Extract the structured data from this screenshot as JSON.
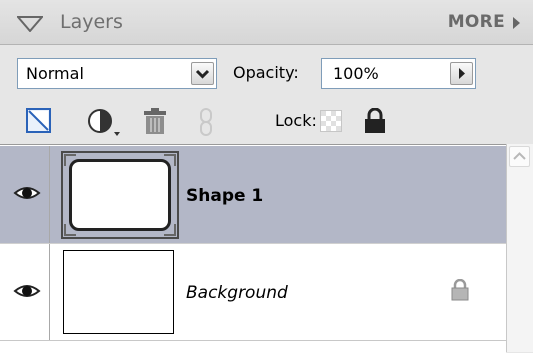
{
  "panel": {
    "title": "Layers",
    "more_label": "MORE",
    "icons": {
      "collapse": "collapse-triangle-icon",
      "more_arrow": "play-arrow-icon"
    }
  },
  "controls": {
    "blend_mode": "Normal",
    "opacity_label": "Opacity:",
    "opacity_value": "100%",
    "lock_label": "Lock:"
  },
  "tools": [
    {
      "name": "new-layer-icon"
    },
    {
      "name": "adjustment-layer-icon"
    },
    {
      "name": "trash-icon"
    },
    {
      "name": "link-icon"
    }
  ],
  "layers": [
    {
      "name": "Shape 1",
      "visible": true,
      "selected": true,
      "locked": false
    },
    {
      "name": "Background",
      "visible": true,
      "selected": false,
      "locked": true
    }
  ],
  "colors": {
    "selection": "#b3b7c7",
    "panel": "#e6e6e6",
    "field_border": "#7f9db9"
  }
}
